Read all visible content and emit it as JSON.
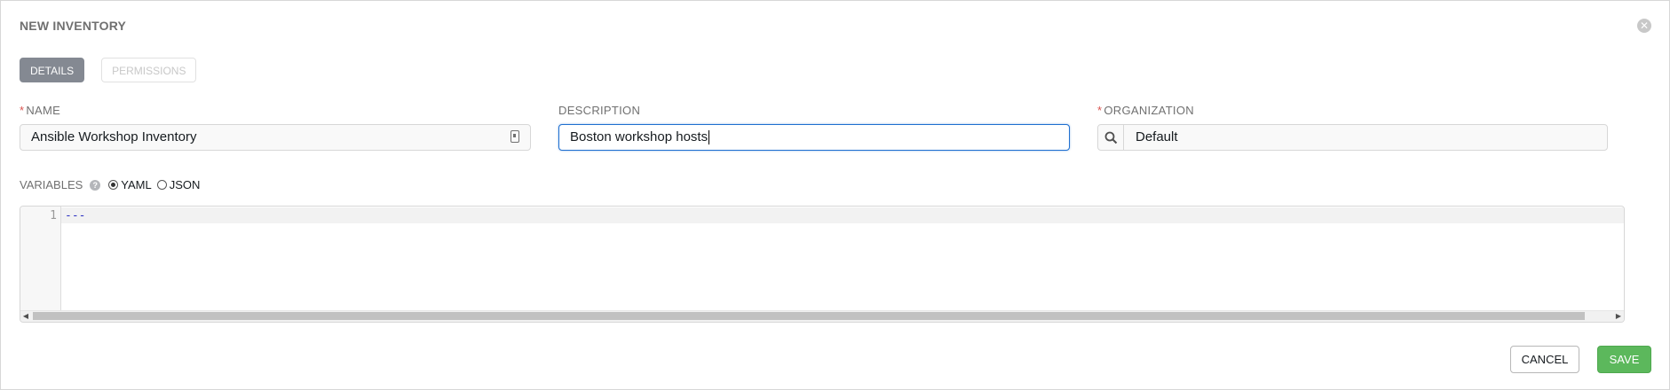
{
  "panel": {
    "title": "NEW INVENTORY"
  },
  "tabs": [
    {
      "label": "DETAILS",
      "state": "active"
    },
    {
      "label": "PERMISSIONS",
      "state": "disabled"
    }
  ],
  "form": {
    "name": {
      "label": "NAME",
      "required": true,
      "value": "Ansible Workshop Inventory"
    },
    "description": {
      "label": "DESCRIPTION",
      "required": false,
      "value": "Boston workshop hosts"
    },
    "organization": {
      "label": "ORGANIZATION",
      "required": true,
      "value": "Default"
    }
  },
  "variables": {
    "label": "VARIABLES",
    "help_icon": "question-circle-icon",
    "options": [
      {
        "label": "YAML",
        "selected": true
      },
      {
        "label": "JSON",
        "selected": false
      }
    ],
    "editor": {
      "line_numbers": [
        "1"
      ],
      "lines": [
        "---"
      ]
    }
  },
  "actions": {
    "cancel_label": "CANCEL",
    "save_label": "SAVE"
  },
  "colors": {
    "save": "#5cb85c",
    "required": "#d9534f",
    "active_tab": "#848992",
    "focus": "#1f6fd0"
  }
}
